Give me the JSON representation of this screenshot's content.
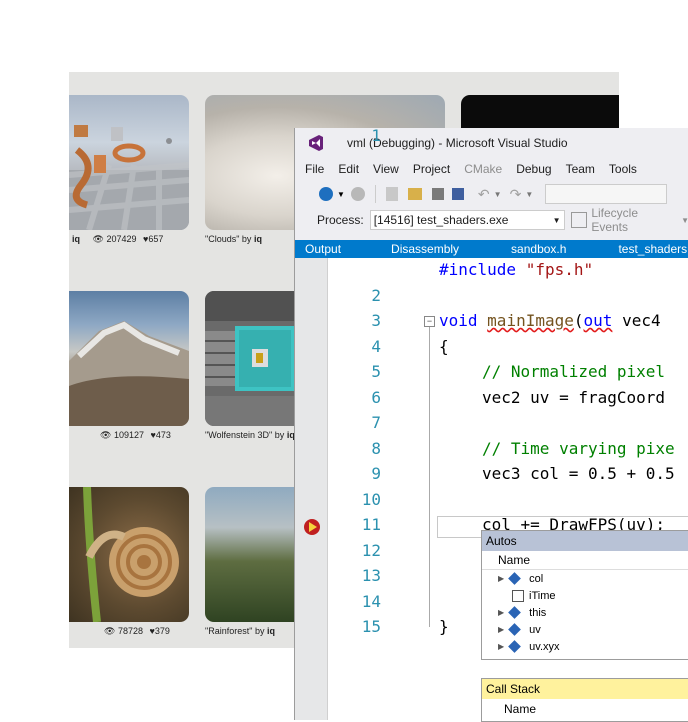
{
  "gallery": {
    "items": [
      {
        "title": "",
        "author": "iq",
        "views": "207429",
        "likes": "657"
      },
      {
        "title": "\"Clouds\"",
        "author": "iq",
        "views": "",
        "likes": ""
      },
      {
        "title": "",
        "author": "",
        "views": "109127",
        "likes": "473"
      },
      {
        "title": "\"Wolfenstein 3D\"",
        "author": "iq",
        "views": "",
        "likes": ""
      },
      {
        "title": "",
        "author": "",
        "views": "78728",
        "likes": "379"
      },
      {
        "title": "\"Rainforest\"",
        "author": "iq",
        "views": "",
        "likes": ""
      }
    ],
    "by_label": "by"
  },
  "vs": {
    "title": "vml (Debugging) - Microsoft Visual Studio",
    "menu": [
      "File",
      "Edit",
      "View",
      "Project",
      "CMake",
      "Debug",
      "Team",
      "Tools"
    ],
    "process_label": "Process:",
    "process_value": "[14516] test_shaders.exe",
    "lifecycle_label": "Lifecycle Events",
    "tabs": [
      "Output",
      "Disassembly",
      "sandbox.h",
      "test_shaders.cpp"
    ],
    "code_lines": [
      {
        "n": "1"
      },
      {
        "n": "2"
      },
      {
        "n": "3"
      },
      {
        "n": "4"
      },
      {
        "n": "5"
      },
      {
        "n": "6"
      },
      {
        "n": "7"
      },
      {
        "n": "8"
      },
      {
        "n": "9"
      },
      {
        "n": "10"
      },
      {
        "n": "11"
      },
      {
        "n": "12"
      },
      {
        "n": "13"
      },
      {
        "n": "14"
      },
      {
        "n": "15"
      }
    ],
    "code": {
      "l1_kw": "#include",
      "l1_str": "\"fps.h\"",
      "l3_void": "void",
      "l3_fn": "mainImage",
      "l3_out": "out",
      "l3_rest": "vec4",
      "l4": "{",
      "l5": "// Normalized pixel",
      "l6": "vec2 uv = fragCoord",
      "l8": "// Time varying pixe",
      "l9": "vec3 col = 0.5 + 0.5",
      "l11": "col += DrawFPS(uv);",
      "l15": "}"
    },
    "autos": {
      "title": "Autos",
      "header": "Name",
      "rows": [
        "col",
        "iTime",
        "this",
        "uv",
        "uv.xyx"
      ]
    },
    "callstack": {
      "title": "Call Stack",
      "header": "Name"
    }
  }
}
